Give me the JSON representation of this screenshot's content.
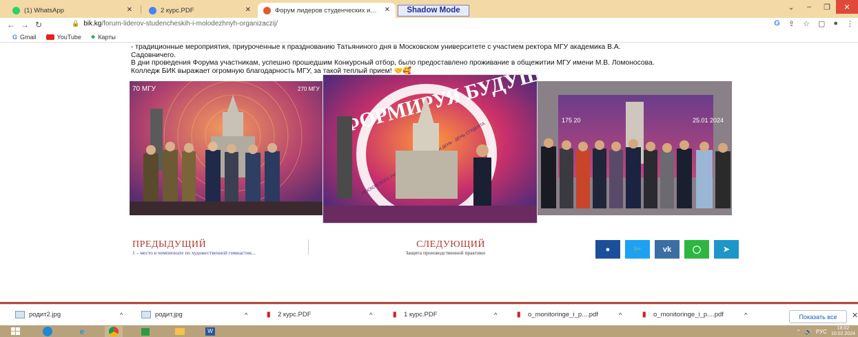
{
  "tabs": [
    {
      "label": "(1) WhatsApp",
      "icon": "whatsapp-icon",
      "color": "#25d366"
    },
    {
      "label": "2 курс.PDF",
      "icon": "chrome-icon",
      "color": "#4285f4"
    },
    {
      "label": "Форум лидеров студенческих и…",
      "icon": "site-icon",
      "color": "#e05a2b"
    }
  ],
  "shadow_mode": "Shadow Mode",
  "address": {
    "host": "bik.kg",
    "path": "/forum-liderov-studencheskih-i-molodezhnyh-organizaczij/"
  },
  "bookmarks": [
    {
      "label": "Gmail",
      "icon": "gmail-icon"
    },
    {
      "label": "YouTube",
      "icon": "youtube-icon"
    },
    {
      "label": "Карты",
      "icon": "maps-icon"
    }
  ],
  "article": {
    "line1": "- традиционные мероприятия, приуроченные к празднованию Татьяниного дня в Московском университете с участием ректора МГУ академика В.А.",
    "line2": "Садовничего.",
    "line3": "В дни проведения Форума участникам, успешно прошедшим Конкурсный отбор, было предоставлено проживание в общежитии МГУ имени М.В. Ломоносова.",
    "line4": "Колледж БИК выражает огромную благодарность МГУ, за такой теплый прием!"
  },
  "photos": {
    "p1_badge_left": "70 МГУ",
    "p1_badge_right": "270 МГУ",
    "p2_title": "ФОРМИРУЯ БУДУЩ",
    "p2_ring": "МОСКОВСКОГО УНИВЕРСИТЕТА · ТАТЬЯНИН ДЕНЬ · ДЕНЬ СТУДЕНТА",
    "p3_left": "175\n20",
    "p3_right": "25.01\n2024"
  },
  "pager": {
    "prev_title": "ПРЕДЫДУЩИЙ",
    "prev_sub": "1 – место в чемпионате по художественной гимнастик...",
    "next_title": "СЛЕДУЮЩИЙ",
    "next_sub": "Защита производственной практики"
  },
  "share": [
    {
      "icon": "facebook-icon",
      "color": "#1b4f9c",
      "glyph": "f"
    },
    {
      "icon": "twitter-icon",
      "color": "#1da1f2",
      "glyph": "t"
    },
    {
      "icon": "vk-icon",
      "color": "#3a6ea5",
      "glyph": "vk"
    },
    {
      "icon": "whatsapp-icon",
      "color": "#2db742",
      "glyph": "w"
    },
    {
      "icon": "telegram-icon",
      "color": "#1e96c8",
      "glyph": "➤"
    }
  ],
  "downloads": [
    {
      "name": "родит2.jpg",
      "type": "image"
    },
    {
      "name": "родит.jpg",
      "type": "image"
    },
    {
      "name": "2 курс.PDF",
      "type": "pdf"
    },
    {
      "name": "1 курс.PDF",
      "type": "pdf"
    },
    {
      "name": "o_monitoringe_i_p....pdf",
      "type": "pdf"
    },
    {
      "name": "o_monitoringe_i_p....pdf",
      "type": "pdf"
    }
  ],
  "show_all": "Показать все",
  "tray": {
    "lang": "РУС",
    "time": "18:02",
    "date": "10.02.2024"
  }
}
